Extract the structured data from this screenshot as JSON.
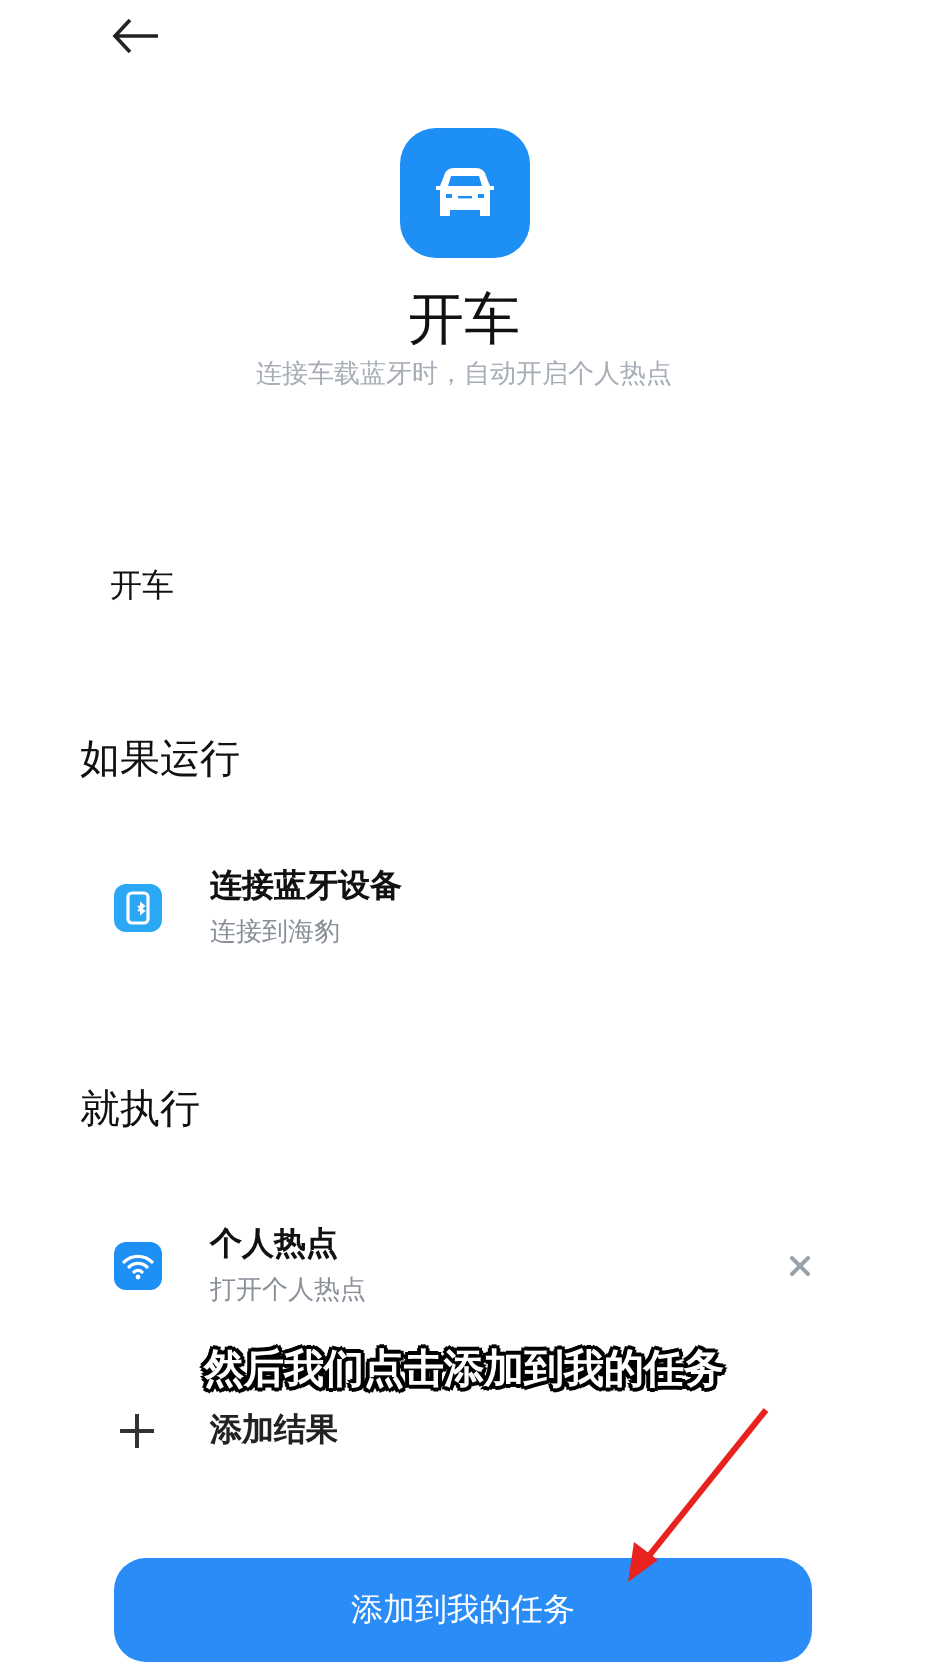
{
  "header": {
    "title": "开车",
    "description": "连接车载蓝牙时，自动开启个人热点"
  },
  "task_name": "开车",
  "sections": [
    {
      "heading": "如果运行",
      "items": [
        {
          "kind": "bluetooth",
          "title": "连接蓝牙设备",
          "subtitle": "连接到海豹",
          "removable": false
        }
      ]
    },
    {
      "heading": "就执行",
      "items": [
        {
          "kind": "hotspot",
          "title": "个人热点",
          "subtitle": "打开个人热点",
          "removable": true
        }
      ],
      "add_label": "添加结果"
    }
  ],
  "primary_button": "添加到我的任务",
  "caption": "然后我们点击添加到我的任务"
}
